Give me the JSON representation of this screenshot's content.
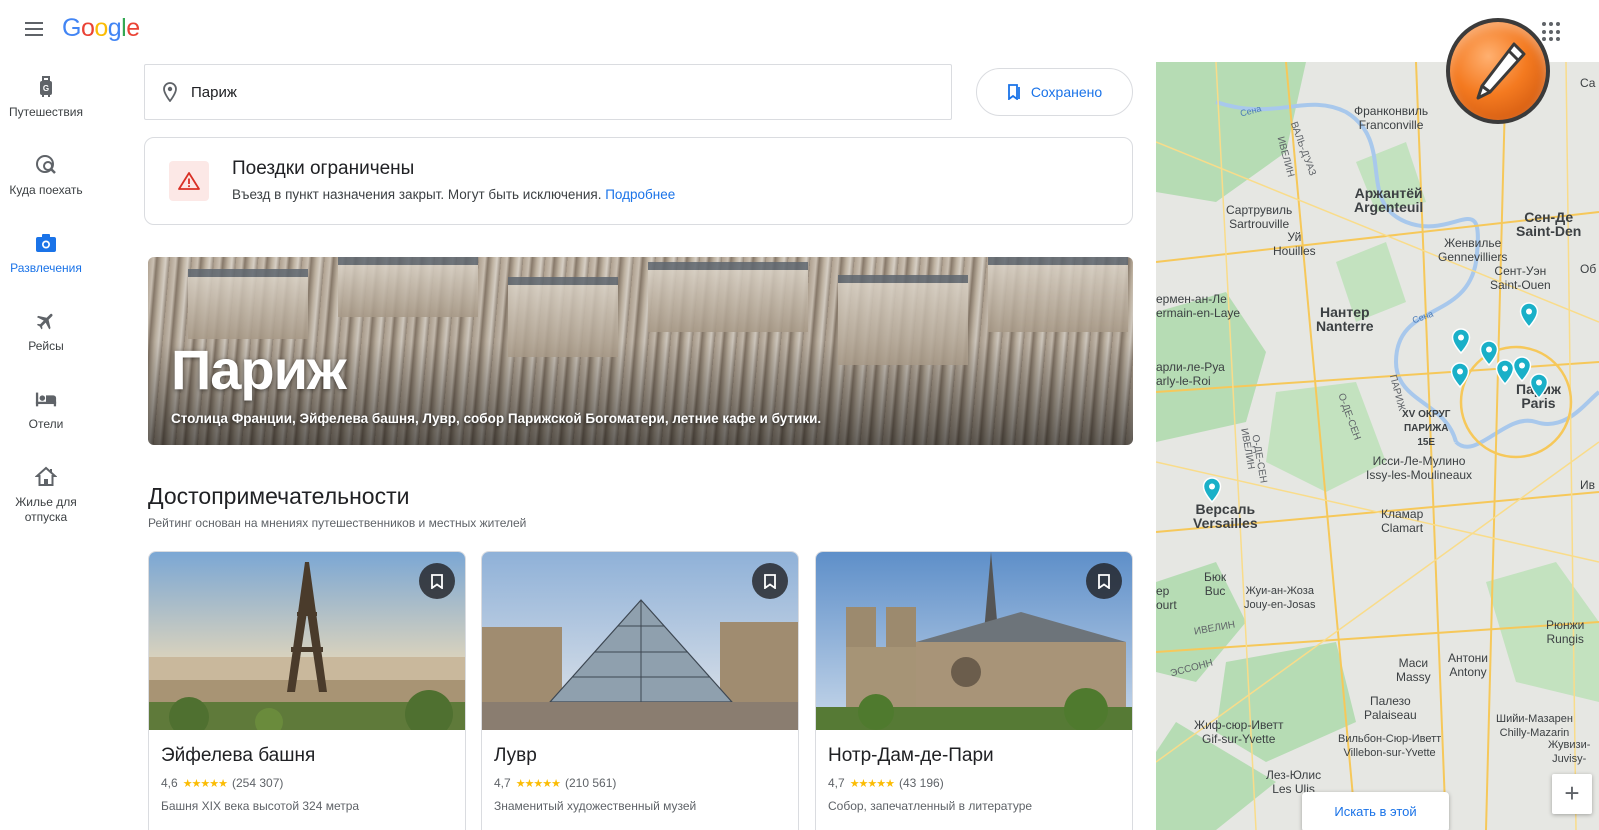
{
  "header": {
    "logo": {
      "g1": "G",
      "o1": "o",
      "o2": "o",
      "g2": "g",
      "l": "l",
      "e": "e"
    }
  },
  "sidebar": {
    "items": [
      {
        "label": "Путешествия",
        "icon": "luggage-icon",
        "active": false
      },
      {
        "label": "Куда поехать",
        "icon": "explore-icon",
        "active": false
      },
      {
        "label": "Развлечения",
        "icon": "camera-icon",
        "active": true
      },
      {
        "label": "Рейсы",
        "icon": "flight-icon",
        "active": false
      },
      {
        "label": "Отели",
        "icon": "hotel-icon",
        "active": false
      },
      {
        "label": "Жилье для отпуска",
        "icon": "house-icon",
        "active": false
      }
    ]
  },
  "search": {
    "value": "Париж",
    "placeholder": ""
  },
  "saved": {
    "label": "Сохранено"
  },
  "alert": {
    "title": "Поездки ограничены",
    "body": "Въезд в пункт назначения закрыт. Могут быть исключения.",
    "link": "Подробнее"
  },
  "hero": {
    "title": "Париж",
    "subtitle": "Столица Франции, Эйфелева башня, Лувр, собор Парижской Богоматери, летние кафе и бутики."
  },
  "section": {
    "title": "Достопримечательности",
    "subtitle": "Рейтинг основан на мнениях путешественников и местных жителей"
  },
  "cards": [
    {
      "name": "Эйфелева башня",
      "rating": "4,6",
      "stars": "★★★★★",
      "reviews": "(254 307)",
      "desc": "Башня XIX века высотой 324 метра"
    },
    {
      "name": "Лувр",
      "rating": "4,7",
      "stars": "★★★★★",
      "reviews": "(210 561)",
      "desc": "Знаменитый художественный музей"
    },
    {
      "name": "Нотр-Дам-де-Пари",
      "rating": "4,7",
      "stars": "★★★★★",
      "reviews": "(43 196)",
      "desc": "Собор, запечатленный в литературе"
    }
  ],
  "map": {
    "labels": {
      "franconville": "Франконвиль\nFranconville",
      "argenteuil": "Аржантёй\nArgenteuil",
      "sartrouville": "Сартрувиль\nSartrouville",
      "houilles": "Уй\nHouilles",
      "gennevilliers": "Женвилье\nGennevilliers",
      "saint_ouen": "Сент-Уэн\nSaint-Ouen",
      "saint_denis": "Сен-Де\nSaint-Den",
      "nanterre": "Нантер\nNanterre",
      "saint_germain": "ермен-ан-Ле\nermain-en-Laye",
      "marly": "арли-ле-Руа\narly-le-Roi",
      "paris": "Париж\nParis",
      "xv": "XV ОКРУГ\nПАРИЖА\n15E",
      "issy": "Исси-Ле-Мулино\nIssy-les-Moulineaux",
      "versailles": "Версаль\nVersailles",
      "clamart": "Кламар\nClamart",
      "buc": "Бюк\nBuc",
      "jouy": "Жуи-ан-Жоза\nJouy-en-Josas",
      "court": "ер\nourt",
      "antony": "Антони\nAntony",
      "rungis": "Рюнжи\nRungis",
      "massy": "Маси\nMassy",
      "palaiseau": "Палезо\nPalaiseau",
      "gif": "Жиф-сюр-Иветт\nGif-sur-Yvette",
      "villebon": "Вильбон-Сюр-Иветт\nVillebon-sur-Yvette",
      "chilly": "Шийи-Мазарен\nChilly-Mazarin",
      "juvisy": "Жувизи-\nJuvisy-",
      "les_ulis": "Лез-Юлис\nLes Ulis",
      "ivelin_1": "ИВЕЛИН",
      "ivelin_2": "ИВЕЛИН",
      "ivelin_3": "ИВЕЛИН",
      "val_doise": "ВАЛЬ-Д'УАЗ",
      "o_de_sen_1": "О-ДЕ-СЕН",
      "o_de_sen_2": "О-ДЕ-СЕН",
      "paris_vert": "ПАРИЖ",
      "essonne": "ЭССОНН",
      "seine_1": "Сена",
      "seine_2": "Сена",
      "sa": "Са",
      "ob": "Об",
      "iv": "Ив"
    },
    "search_btn": "Искать в этой",
    "zoom_in": "+"
  }
}
